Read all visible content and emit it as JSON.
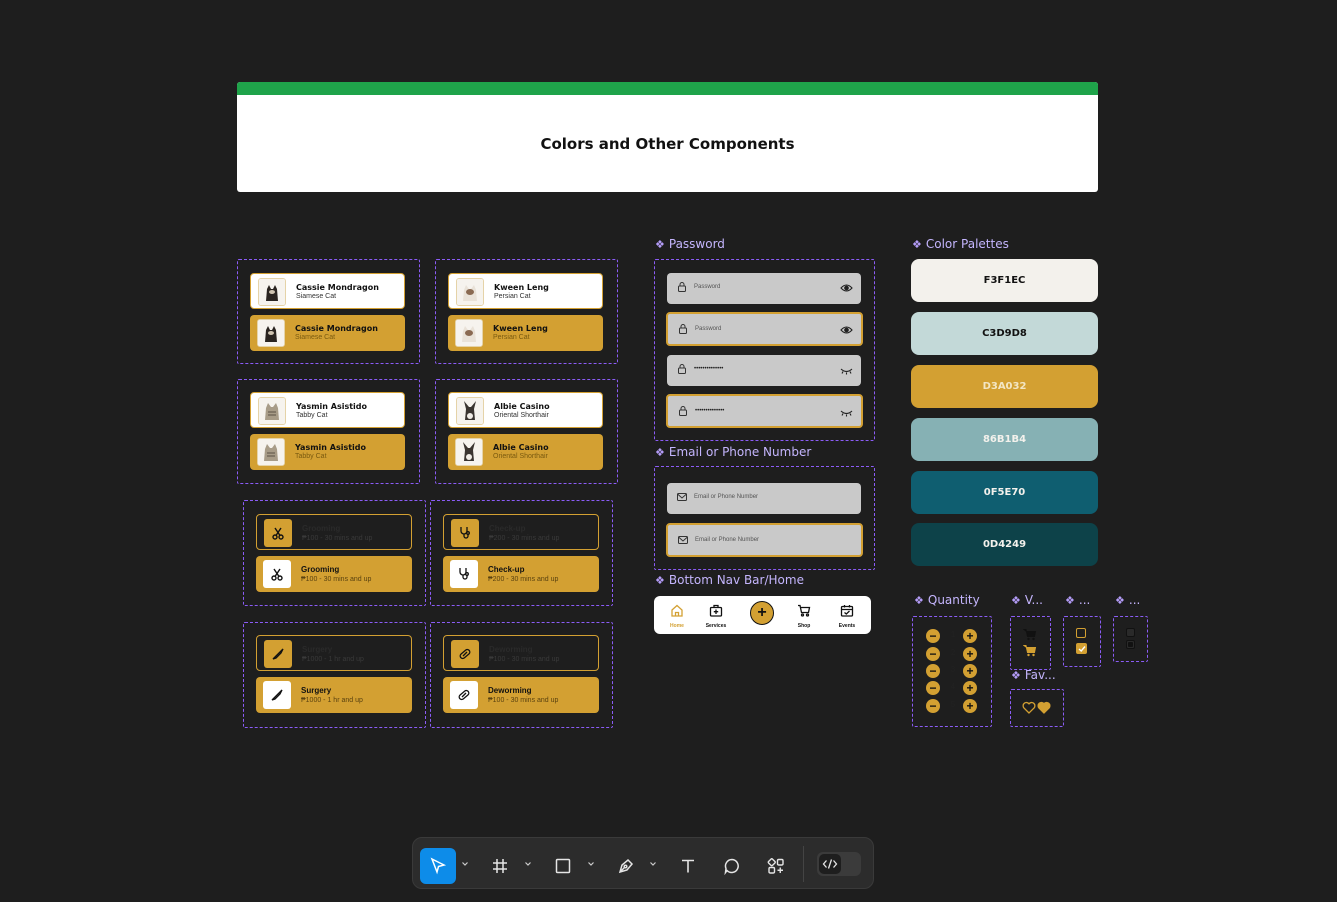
{
  "header": {
    "title": "Colors and Other Components"
  },
  "pet_cards": [
    {
      "name": "Cassie Mondragon",
      "breed": "Siamese Cat"
    },
    {
      "name": "Kween Leng",
      "breed": "Persian Cat"
    },
    {
      "name": "Yasmin Asistido",
      "breed": "Tabby Cat"
    },
    {
      "name": "Albie Casino",
      "breed": "Oriental Shorthair"
    }
  ],
  "services": [
    {
      "name": "Grooming",
      "price": "₱100 - 30 mins and up",
      "icon": "scissors-icon"
    },
    {
      "name": "Check-up",
      "price": "₱200 - 30 mins and up",
      "icon": "stethoscope-icon"
    },
    {
      "name": "Surgery",
      "price": "₱1000 - 1 hr and up",
      "icon": "scalpel-icon"
    },
    {
      "name": "Deworming",
      "price": "₱100 - 30 mins and up",
      "icon": "pill-icon"
    }
  ],
  "password": {
    "label": "Password",
    "placeholder": "Password",
    "masked": "••••••••••••••"
  },
  "email": {
    "label": "Email or Phone Number",
    "placeholder": "Email or Phone Number"
  },
  "bottom_nav": {
    "label": "Bottom Nav Bar/Home",
    "items": [
      "Home",
      "Services",
      "Shop",
      "Events"
    ],
    "plus": "+"
  },
  "palette": {
    "label": "Color Palettes",
    "colors": [
      {
        "hex": "F3F1EC",
        "color": "#F3F1EC",
        "text": "#111111"
      },
      {
        "hex": "C3D9D8",
        "color": "#C3D9D8",
        "text": "#111111"
      },
      {
        "hex": "D3A032",
        "color": "#D3A032",
        "text": "#F3E6C4"
      },
      {
        "hex": "86B1B4",
        "color": "#86B1B4",
        "text": "#F3F1EC"
      },
      {
        "hex": "0F5E70",
        "color": "#0F5E70",
        "text": "#F3F1EC"
      },
      {
        "hex": "0D4249",
        "color": "#0D4249",
        "text": "#F3F1EC"
      }
    ]
  },
  "small_components": {
    "quantity_label": "Quantity",
    "quantity_values": [
      "1",
      "2",
      "3",
      "4",
      "5"
    ],
    "v_label": "V...",
    "check_label": "...",
    "radio_label": "...",
    "fav_label": "Fav..."
  },
  "toolbar": {
    "tools": [
      "move-tool",
      "frame-tool",
      "shape-tool",
      "pen-tool",
      "text-tool",
      "comment-tool",
      "actions-tool",
      "dev-mode-toggle"
    ]
  },
  "accent": "#D3A032",
  "header_bar_color": "#1FA34A"
}
